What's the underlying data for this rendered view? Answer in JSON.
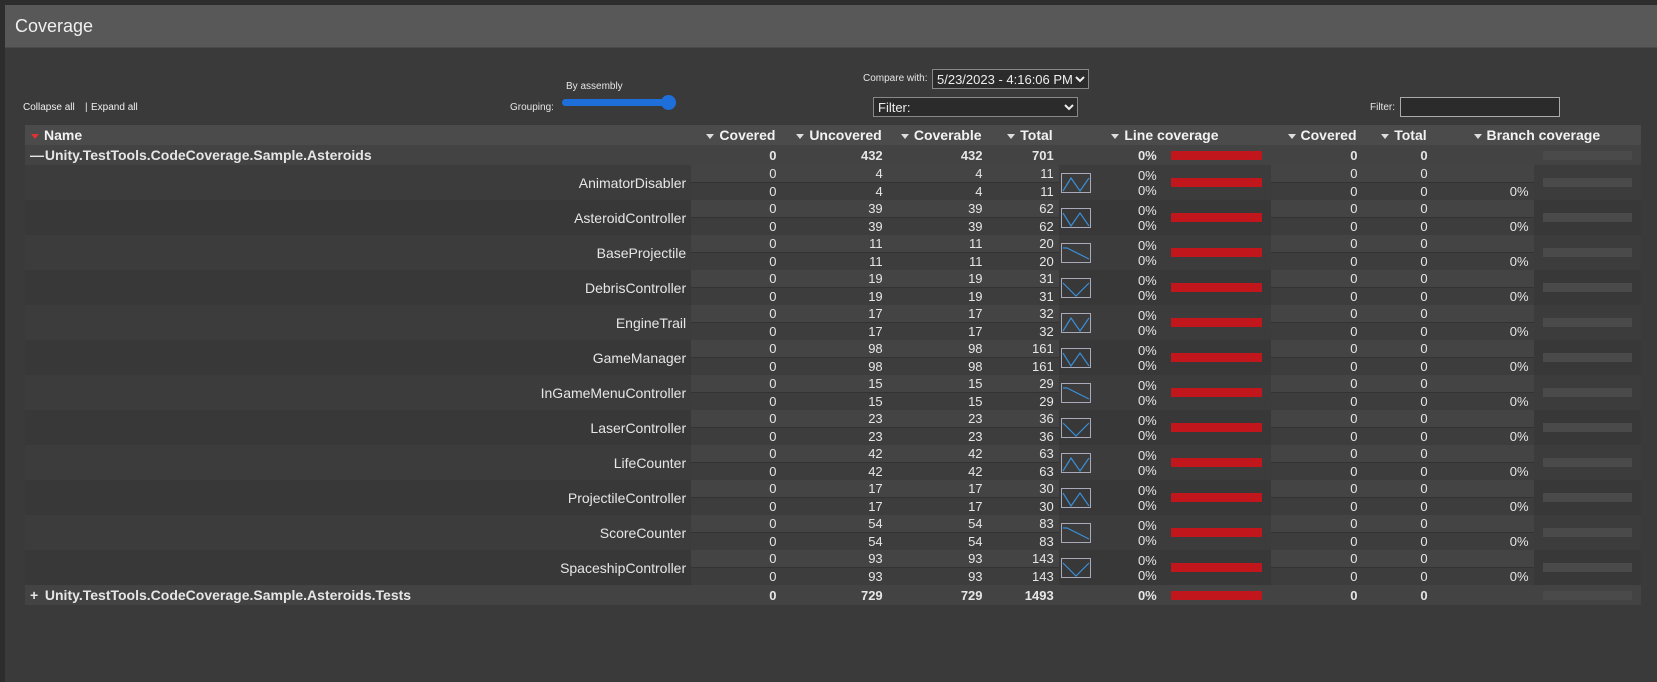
{
  "title": "Coverage",
  "toolbar": {
    "collapse_all": "Collapse all",
    "separator": "|",
    "expand_all": "Expand all",
    "grouping_label": "Grouping:",
    "grouping_value": "By assembly",
    "compare_label": "Compare with:",
    "compare_value": "5/23/2023 - 4:16:06 PM",
    "filter_select": "Filter:",
    "filter_label": "Filter:",
    "filter_value": ""
  },
  "columns": {
    "name": "Name",
    "covered": "Covered",
    "uncovered": "Uncovered",
    "coverable": "Coverable",
    "total": "Total",
    "line_coverage": "Line coverage",
    "branch_covered": "Covered",
    "branch_total": "Total",
    "branch_coverage": "Branch coverage"
  },
  "assemblies": [
    {
      "name": "Unity.TestTools.CodeCoverage.Sample.Asteroids",
      "expanded": true,
      "covered": "0",
      "uncovered": "432",
      "coverable": "432",
      "total": "701",
      "line_pct": "0%",
      "branch_covered": "0",
      "branch_total": "0"
    },
    {
      "name": "Unity.TestTools.CodeCoverage.Sample.Asteroids.Tests",
      "expanded": false,
      "covered": "0",
      "uncovered": "729",
      "coverable": "729",
      "total": "1493",
      "line_pct": "0%",
      "branch_covered": "0",
      "branch_total": "0"
    }
  ],
  "classes": [
    {
      "name": "AnimatorDisabler",
      "covered": [
        "0",
        "0"
      ],
      "uncovered": [
        "4",
        "4"
      ],
      "coverable": [
        "4",
        "4"
      ],
      "total": [
        "11",
        "11"
      ],
      "line": [
        "0%",
        "0%"
      ],
      "bcov": [
        "0",
        "0"
      ],
      "btot": [
        "0",
        "0"
      ],
      "bpct": "0%"
    },
    {
      "name": "AsteroidController",
      "covered": [
        "0",
        "0"
      ],
      "uncovered": [
        "39",
        "39"
      ],
      "coverable": [
        "39",
        "39"
      ],
      "total": [
        "62",
        "62"
      ],
      "line": [
        "0%",
        "0%"
      ],
      "bcov": [
        "0",
        "0"
      ],
      "btot": [
        "0",
        "0"
      ],
      "bpct": "0%"
    },
    {
      "name": "BaseProjectile",
      "covered": [
        "0",
        "0"
      ],
      "uncovered": [
        "11",
        "11"
      ],
      "coverable": [
        "11",
        "11"
      ],
      "total": [
        "20",
        "20"
      ],
      "line": [
        "0%",
        "0%"
      ],
      "bcov": [
        "0",
        "0"
      ],
      "btot": [
        "0",
        "0"
      ],
      "bpct": "0%"
    },
    {
      "name": "DebrisController",
      "covered": [
        "0",
        "0"
      ],
      "uncovered": [
        "19",
        "19"
      ],
      "coverable": [
        "19",
        "19"
      ],
      "total": [
        "31",
        "31"
      ],
      "line": [
        "0%",
        "0%"
      ],
      "bcov": [
        "0",
        "0"
      ],
      "btot": [
        "0",
        "0"
      ],
      "bpct": "0%"
    },
    {
      "name": "EngineTrail",
      "covered": [
        "0",
        "0"
      ],
      "uncovered": [
        "17",
        "17"
      ],
      "coverable": [
        "17",
        "17"
      ],
      "total": [
        "32",
        "32"
      ],
      "line": [
        "0%",
        "0%"
      ],
      "bcov": [
        "0",
        "0"
      ],
      "btot": [
        "0",
        "0"
      ],
      "bpct": "0%"
    },
    {
      "name": "GameManager",
      "covered": [
        "0",
        "0"
      ],
      "uncovered": [
        "98",
        "98"
      ],
      "coverable": [
        "98",
        "98"
      ],
      "total": [
        "161",
        "161"
      ],
      "line": [
        "0%",
        "0%"
      ],
      "bcov": [
        "0",
        "0"
      ],
      "btot": [
        "0",
        "0"
      ],
      "bpct": "0%"
    },
    {
      "name": "InGameMenuController",
      "covered": [
        "0",
        "0"
      ],
      "uncovered": [
        "15",
        "15"
      ],
      "coverable": [
        "15",
        "15"
      ],
      "total": [
        "29",
        "29"
      ],
      "line": [
        "0%",
        "0%"
      ],
      "bcov": [
        "0",
        "0"
      ],
      "btot": [
        "0",
        "0"
      ],
      "bpct": "0%"
    },
    {
      "name": "LaserController",
      "covered": [
        "0",
        "0"
      ],
      "uncovered": [
        "23",
        "23"
      ],
      "coverable": [
        "23",
        "23"
      ],
      "total": [
        "36",
        "36"
      ],
      "line": [
        "0%",
        "0%"
      ],
      "bcov": [
        "0",
        "0"
      ],
      "btot": [
        "0",
        "0"
      ],
      "bpct": "0%"
    },
    {
      "name": "LifeCounter",
      "covered": [
        "0",
        "0"
      ],
      "uncovered": [
        "42",
        "42"
      ],
      "coverable": [
        "42",
        "42"
      ],
      "total": [
        "63",
        "63"
      ],
      "line": [
        "0%",
        "0%"
      ],
      "bcov": [
        "0",
        "0"
      ],
      "btot": [
        "0",
        "0"
      ],
      "bpct": "0%"
    },
    {
      "name": "ProjectileController",
      "covered": [
        "0",
        "0"
      ],
      "uncovered": [
        "17",
        "17"
      ],
      "coverable": [
        "17",
        "17"
      ],
      "total": [
        "30",
        "30"
      ],
      "line": [
        "0%",
        "0%"
      ],
      "bcov": [
        "0",
        "0"
      ],
      "btot": [
        "0",
        "0"
      ],
      "bpct": "0%"
    },
    {
      "name": "ScoreCounter",
      "covered": [
        "0",
        "0"
      ],
      "uncovered": [
        "54",
        "54"
      ],
      "coverable": [
        "54",
        "54"
      ],
      "total": [
        "83",
        "83"
      ],
      "line": [
        "0%",
        "0%"
      ],
      "bcov": [
        "0",
        "0"
      ],
      "btot": [
        "0",
        "0"
      ],
      "bpct": "0%"
    },
    {
      "name": "SpaceshipController",
      "covered": [
        "0",
        "0"
      ],
      "uncovered": [
        "93",
        "93"
      ],
      "coverable": [
        "93",
        "93"
      ],
      "total": [
        "143",
        "143"
      ],
      "line": [
        "0%",
        "0%"
      ],
      "bcov": [
        "0",
        "0"
      ],
      "btot": [
        "0",
        "0"
      ],
      "bpct": "0%"
    }
  ],
  "colors": {
    "coverage_bar": "#c0161c",
    "slider": "#1e6fd9",
    "sparkline": "#3a8fd8"
  }
}
